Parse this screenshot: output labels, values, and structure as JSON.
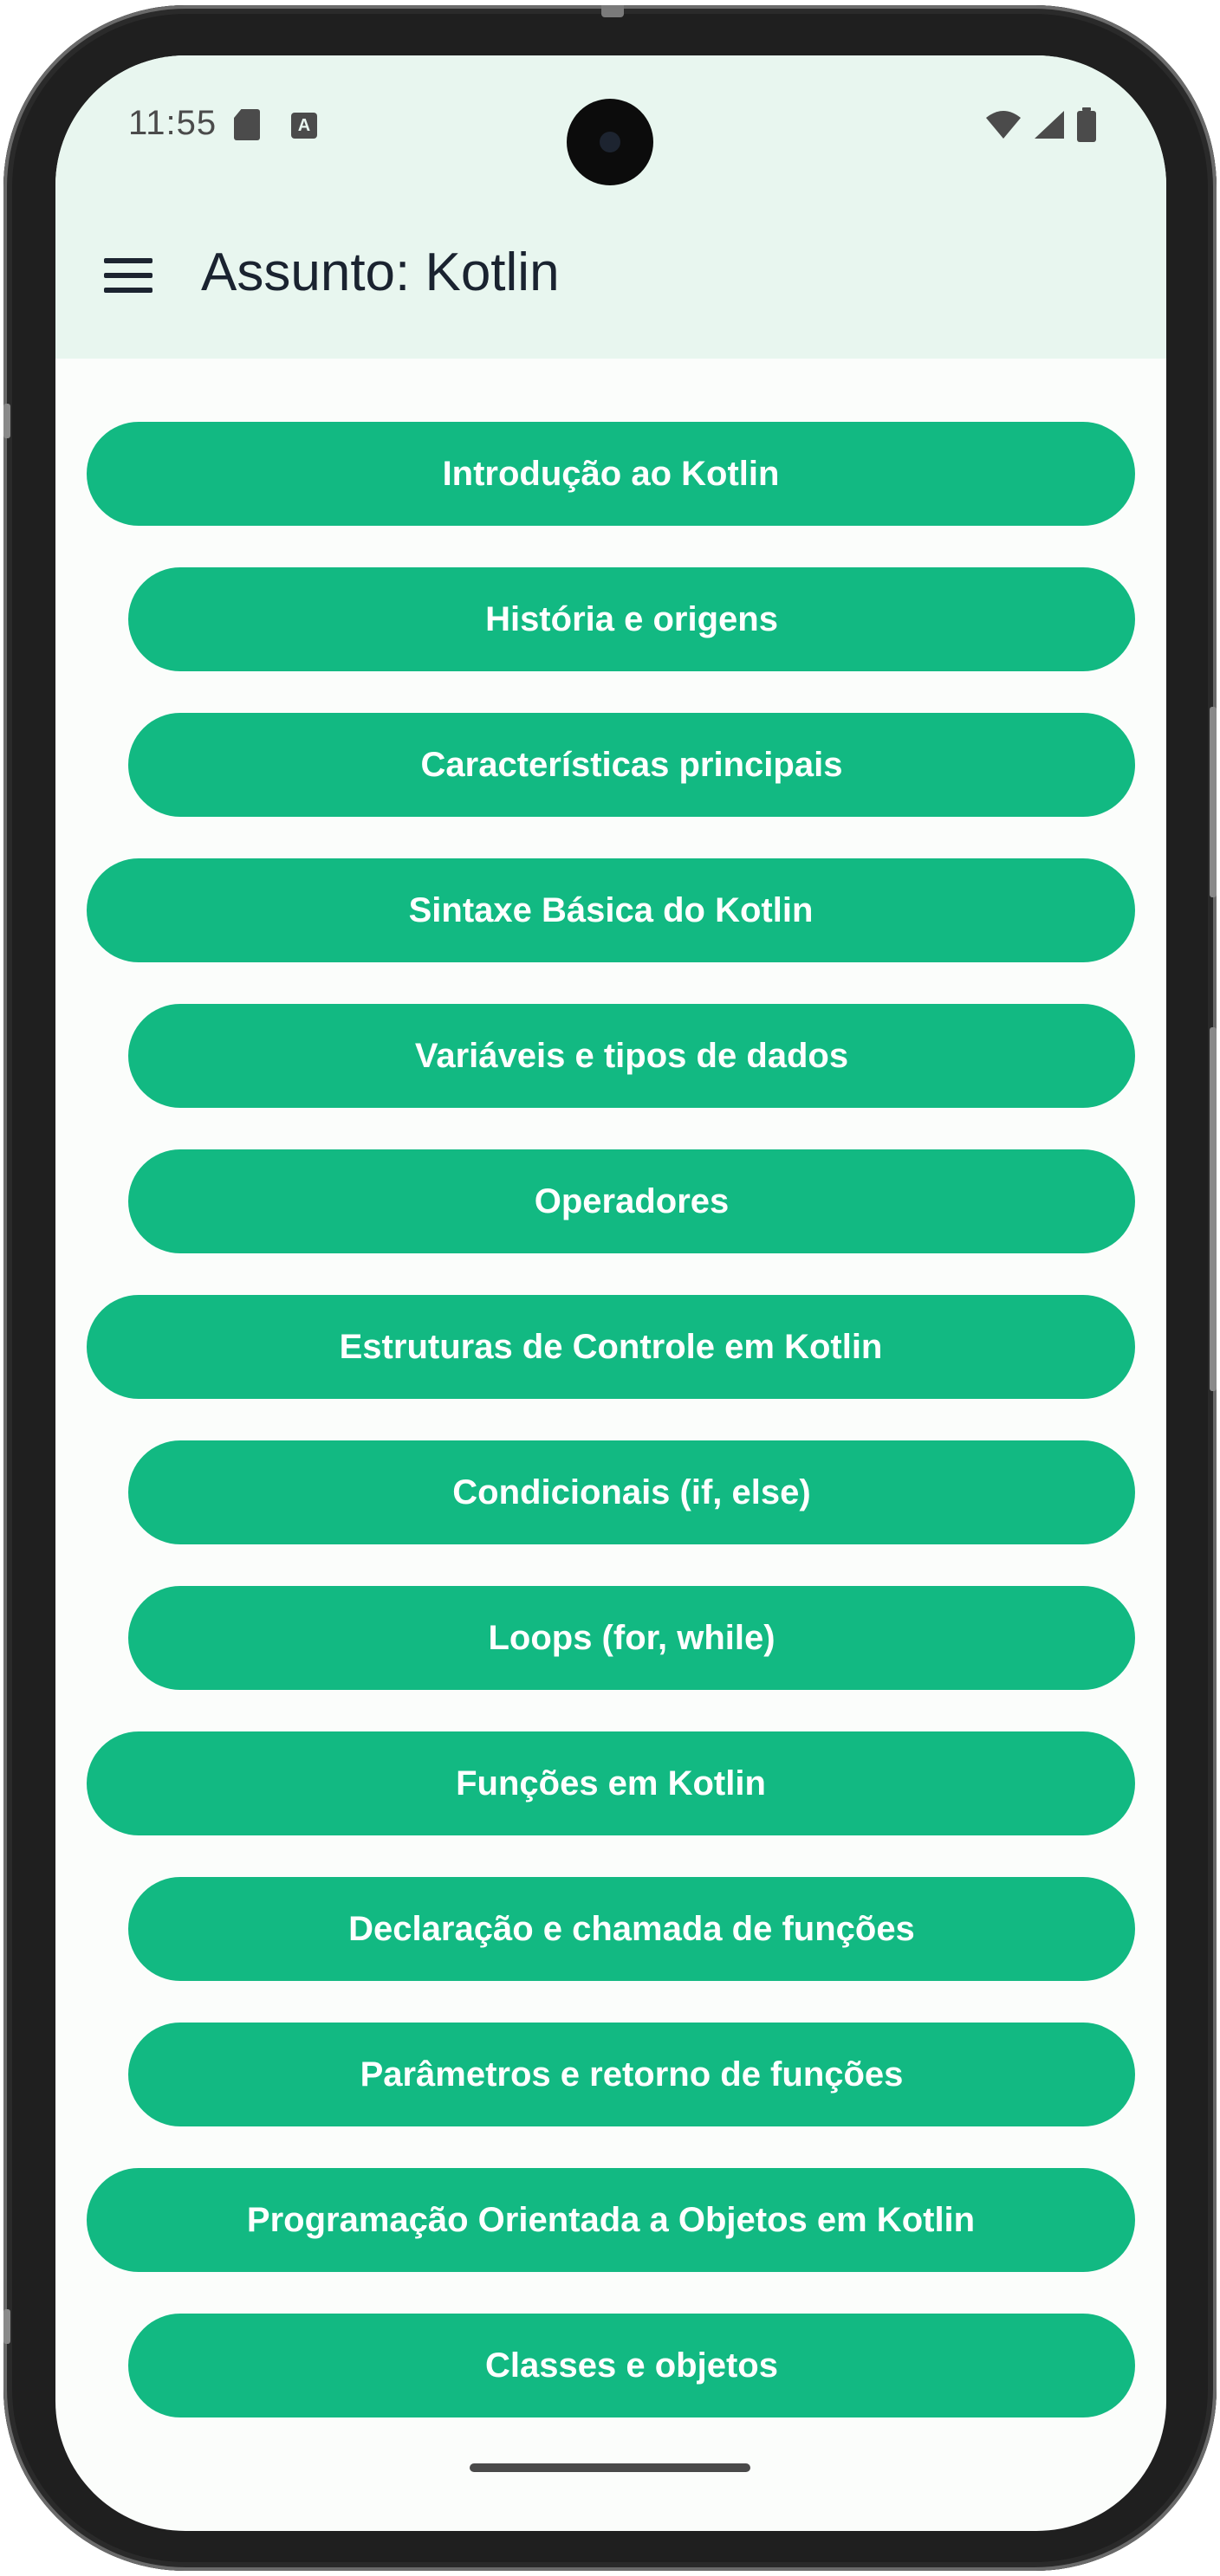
{
  "status_bar": {
    "time": "11:55",
    "icons": [
      "sd-card-icon",
      "keyboard-a-icon",
      "wifi-icon",
      "signal-icon",
      "battery-icon"
    ]
  },
  "app_bar": {
    "menu_icon": "hamburger-menu-icon",
    "title": "Assunto: Kotlin"
  },
  "colors": {
    "header_bg": "#e8f6ef",
    "button_bg": "#12b982",
    "button_text": "#ffffff",
    "title_text": "#1a2330"
  },
  "topics": [
    {
      "label": "Introdução ao Kotlin",
      "level": "main"
    },
    {
      "label": "História e origens",
      "level": "sub"
    },
    {
      "label": "Características principais",
      "level": "sub"
    },
    {
      "label": "Sintaxe Básica do Kotlin",
      "level": "main"
    },
    {
      "label": "Variáveis e tipos de dados",
      "level": "sub"
    },
    {
      "label": "Operadores",
      "level": "sub"
    },
    {
      "label": "Estruturas de Controle em Kotlin",
      "level": "main"
    },
    {
      "label": "Condicionais (if, else)",
      "level": "sub"
    },
    {
      "label": "Loops (for, while)",
      "level": "sub"
    },
    {
      "label": "Funções em Kotlin",
      "level": "main"
    },
    {
      "label": "Declaração e chamada de funções",
      "level": "sub"
    },
    {
      "label": "Parâmetros e retorno de funções",
      "level": "sub"
    },
    {
      "label": "Programação Orientada a Objetos em Kotlin",
      "level": "main"
    },
    {
      "label": "Classes e objetos",
      "level": "sub"
    }
  ]
}
